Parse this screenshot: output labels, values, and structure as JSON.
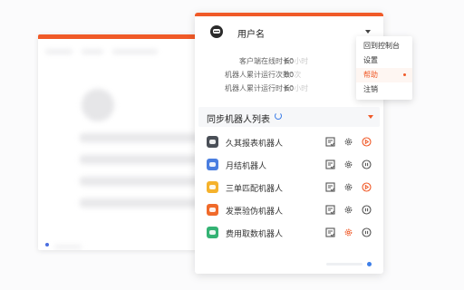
{
  "user": {
    "name": "用户名"
  },
  "stats": [
    {
      "label": "客户端在线时长：",
      "value": "60",
      "faded": "小时"
    },
    {
      "label": "机器人累计运行次数：",
      "value": "60",
      "faded": "次"
    },
    {
      "label": "机器人累计运行时长：",
      "value": "60",
      "faded": "小时"
    }
  ],
  "robot_list": {
    "title": "同步机器人列表",
    "robots": [
      {
        "name": "久其报表机器人",
        "color": "#4a4f57",
        "status": "stop"
      },
      {
        "name": "月结机器人",
        "color": "#4a7ee0",
        "status": "pause"
      },
      {
        "name": "三单匹配机器人",
        "color": "#f5b22c",
        "status": "stop"
      },
      {
        "name": "发票验伪机器人",
        "color": "#f06a2a",
        "status": "pause"
      },
      {
        "name": "费用取数机器人",
        "color": "#34b374",
        "status": "pause",
        "settings_active": true
      }
    ]
  },
  "menu": {
    "items": [
      {
        "label": "回到控制台",
        "active": false
      },
      {
        "label": "设置",
        "active": false
      },
      {
        "label": "帮助",
        "active": true
      },
      {
        "label": "注销",
        "active": false
      }
    ]
  },
  "colors": {
    "accent": "#f05a28",
    "blue": "#3d7ee8"
  }
}
